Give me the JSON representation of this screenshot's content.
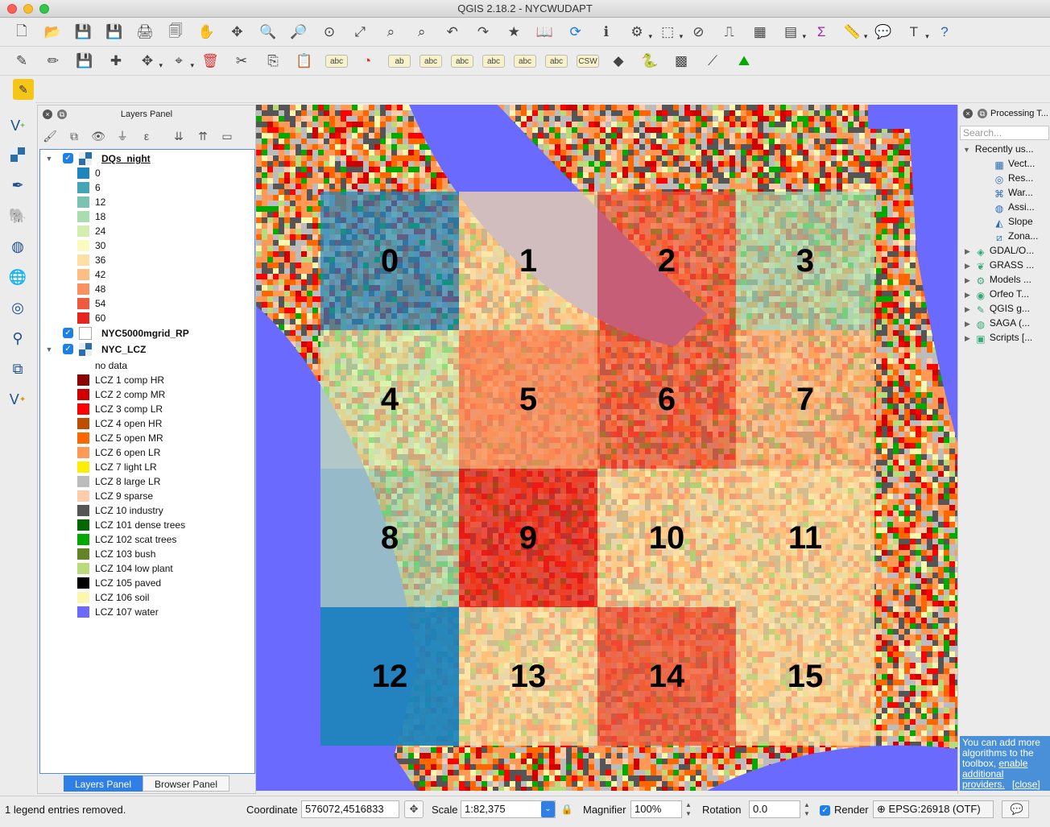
{
  "window": {
    "title": "QGIS 2.18.2 - NYCWUDAPT"
  },
  "toolbar": {
    "row1_icons": [
      "new-project",
      "open-project",
      "save-project",
      "save-as",
      "new-print-composer",
      "composer-manager",
      "pan-map",
      "pan-to-selection",
      "zoom-in",
      "zoom-out",
      "zoom-actual",
      "zoom-full",
      "zoom-to-selection",
      "zoom-to-layer",
      "zoom-last",
      "zoom-next",
      "new-bookmark",
      "show-bookmarks",
      "refresh",
      "identify",
      "run-action",
      "select-features",
      "deselect",
      "measure-line",
      "attribute-table",
      "field-calculator",
      "statistics",
      "measure",
      "annotation",
      "text-annotation",
      "help"
    ],
    "row2_icons": [
      "current-edits",
      "toggle-editing",
      "save-edits",
      "add-feature",
      "move-feature",
      "node-tool",
      "delete-selected",
      "cut-features",
      "copy-features",
      "paste-features",
      "layer-labeling",
      "diagram",
      "label-tool",
      "pin-labels",
      "show-hide-labels",
      "move-label",
      "rotate-label",
      "change-label",
      "csw-search",
      "geoserver",
      "python-console",
      "raster-calculator",
      "georeferencer",
      "terrain-profile"
    ],
    "row3_icons": [
      "plugin-tool"
    ]
  },
  "layers_panel": {
    "title": "Layers Panel",
    "layers": [
      {
        "name": "DQs_night",
        "checked": true,
        "expanded": true,
        "legend": [
          {
            "label": "0",
            "color": "#1f85bd"
          },
          {
            "label": "6",
            "color": "#44a5b5"
          },
          {
            "label": "12",
            "color": "#7ac2b2"
          },
          {
            "label": "18",
            "color": "#a9ddb0"
          },
          {
            "label": "24",
            "color": "#d2efb0"
          },
          {
            "label": "30",
            "color": "#fbfbbf"
          },
          {
            "label": "36",
            "color": "#fee0a3"
          },
          {
            "label": "42",
            "color": "#fdbe83"
          },
          {
            "label": "48",
            "color": "#f99160"
          },
          {
            "label": "54",
            "color": "#ef5a3f"
          },
          {
            "label": "60",
            "color": "#e7241e"
          }
        ]
      },
      {
        "name": "NYC5000mgrid_RP",
        "checked": true,
        "expanded": false,
        "legend": []
      },
      {
        "name": "NYC_LCZ",
        "checked": true,
        "expanded": true,
        "legend": [
          {
            "label": "no data",
            "color": ""
          },
          {
            "label": "LCZ 1 comp HR",
            "color": "#8c0000"
          },
          {
            "label": "LCZ 2 comp MR",
            "color": "#d10000"
          },
          {
            "label": "LCZ 3 comp LR",
            "color": "#ff0000"
          },
          {
            "label": "LCZ 4 open HR",
            "color": "#bf4d00"
          },
          {
            "label": "LCZ 5 open MR",
            "color": "#ff6600"
          },
          {
            "label": "LCZ 6 open LR",
            "color": "#ff9955"
          },
          {
            "label": "LCZ 7 light LR",
            "color": "#faee05"
          },
          {
            "label": "LCZ 8 large LR",
            "color": "#bcbcbc"
          },
          {
            "label": "LCZ 9 sparse",
            "color": "#ffccaa"
          },
          {
            "label": "LCZ 10 industry",
            "color": "#555555"
          },
          {
            "label": "LCZ 101 dense trees",
            "color": "#006a00"
          },
          {
            "label": "LCZ 102 scat trees",
            "color": "#00aa00"
          },
          {
            "label": "LCZ 103 bush",
            "color": "#648525"
          },
          {
            "label": "LCZ 104 low plant",
            "color": "#b9db79"
          },
          {
            "label": "LCZ 105 paved",
            "color": "#000000"
          },
          {
            "label": "LCZ 106 soil",
            "color": "#fbf7ae"
          },
          {
            "label": "LCZ 107 water",
            "color": "#6a6aff"
          }
        ]
      }
    ],
    "tabs": [
      "Layers Panel",
      "Browser Panel"
    ]
  },
  "map": {
    "grid_cells": [
      {
        "id": "0",
        "color": "#1f85bd",
        "opacity": 0.7
      },
      {
        "id": "1",
        "color": "#fee0a3",
        "opacity": 0.7
      },
      {
        "id": "2",
        "color": "#ef5a3f",
        "opacity": 0.7
      },
      {
        "id": "3",
        "color": "#a9ddb0",
        "opacity": 0.7
      },
      {
        "id": "4",
        "color": "#d2efb0",
        "opacity": 0.7
      },
      {
        "id": "5",
        "color": "#f99160",
        "opacity": 0.85
      },
      {
        "id": "6",
        "color": "#ef5a3f",
        "opacity": 0.7
      },
      {
        "id": "7",
        "color": "#fdbe83",
        "opacity": 0.7
      },
      {
        "id": "8",
        "color": "#a9ddb0",
        "opacity": 0.7
      },
      {
        "id": "9",
        "color": "#e7241e",
        "opacity": 0.75
      },
      {
        "id": "10",
        "color": "#fee0a3",
        "opacity": 0.7
      },
      {
        "id": "11",
        "color": "#fee0a3",
        "opacity": 0.75
      },
      {
        "id": "12",
        "color": "#1f85bd",
        "opacity": 0.95
      },
      {
        "id": "13",
        "color": "#fee0a3",
        "opacity": 0.75
      },
      {
        "id": "14",
        "color": "#ef5a3f",
        "opacity": 0.8
      },
      {
        "id": "15",
        "color": "#fee0a3",
        "opacity": 0.75
      }
    ]
  },
  "processing_panel": {
    "title": "Processing T...",
    "search_placeholder": "Search...",
    "recently_used": "Recently us...",
    "recent_items": [
      {
        "label": "Vect...",
        "icon": "vector-grid-icon"
      },
      {
        "label": "Res...",
        "icon": "gdal-icon"
      },
      {
        "label": "War...",
        "icon": "warp-icon"
      },
      {
        "label": "Assi...",
        "icon": "assign-projection-icon"
      },
      {
        "label": "Slope",
        "icon": "slope-icon"
      },
      {
        "label": "Zona...",
        "icon": "zonal-stats-icon"
      }
    ],
    "providers": [
      {
        "label": "GDAL/O...",
        "icon": "gdal-provider-icon"
      },
      {
        "label": "GRASS ...",
        "icon": "grass-icon"
      },
      {
        "label": "Models ...",
        "icon": "models-icon"
      },
      {
        "label": "Orfeo T...",
        "icon": "orfeo-icon"
      },
      {
        "label": "QGIS g...",
        "icon": "qgis-geoalgorithms-icon"
      },
      {
        "label": "SAGA (...",
        "icon": "saga-icon"
      },
      {
        "label": "Scripts [...",
        "icon": "scripts-icon"
      }
    ],
    "note_text": "You can add more algorithms to the toolbox, ",
    "note_link": "enable additional providers.",
    "note_close": "[close]"
  },
  "status": {
    "message": "1 legend entries removed.",
    "coordinate_label": "Coordinate",
    "coordinate_value": "576072,4516833",
    "scale_label": "Scale",
    "scale_value": "1:82,375",
    "magnifier_label": "Magnifier",
    "magnifier_value": "100%",
    "rotation_label": "Rotation",
    "rotation_value": "0.0",
    "render_label": "Render",
    "crs": "EPSG:26918 (OTF)"
  }
}
